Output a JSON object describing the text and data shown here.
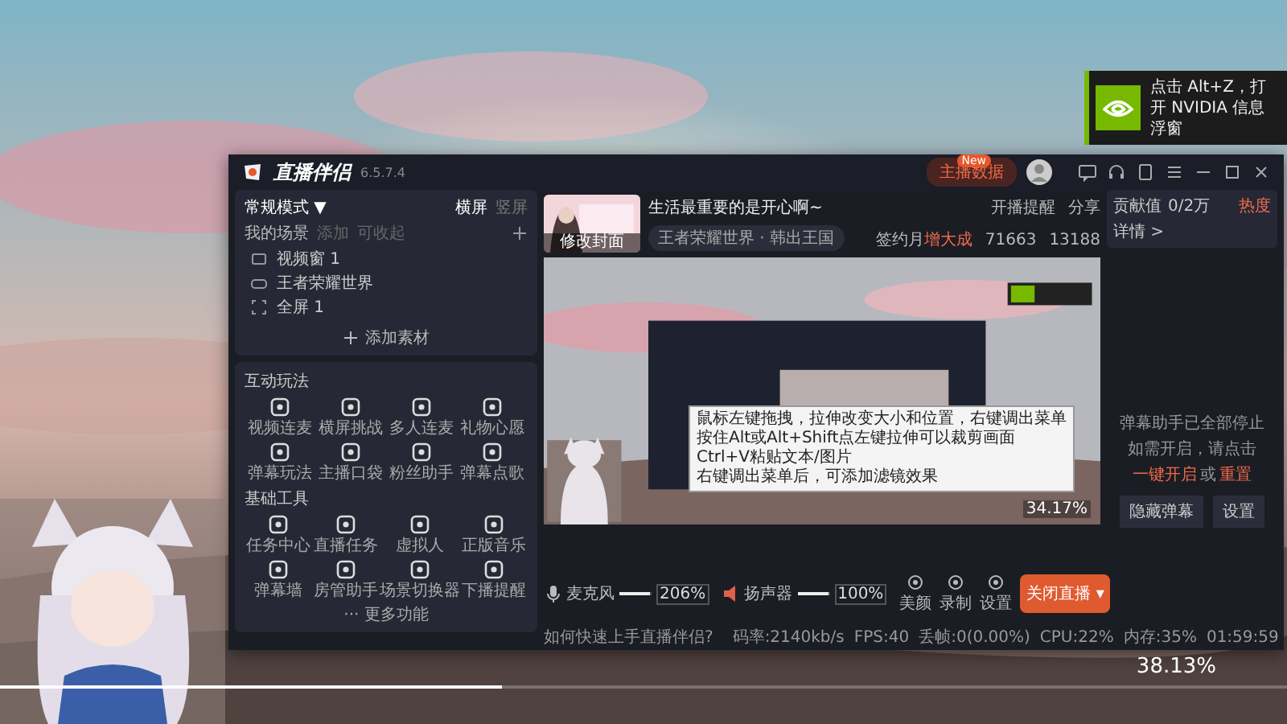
{
  "toast": {
    "text": "点击 Alt+Z，打开 NVIDIA 信息浮窗"
  },
  "app": {
    "name": "直播伴侣",
    "version": "6.5.7.4",
    "data_button": {
      "label": "主播数据",
      "badge": "New"
    }
  },
  "sidebar": {
    "mode": "常规模式 ▼",
    "orientations": [
      {
        "label": "横屏",
        "selected": true
      },
      {
        "label": "竖屏",
        "selected": false
      }
    ],
    "scenes_title": "我的场景",
    "scene_actions": [
      "添加",
      "可收起"
    ],
    "scenes": [
      {
        "kind": "video",
        "label": "视频窗 1"
      },
      {
        "kind": "game",
        "label": "王者荣耀世界"
      },
      {
        "kind": "screen",
        "label": "全屏 1"
      }
    ],
    "add_source": "添加素材",
    "sections": [
      {
        "title": "互动玩法",
        "tools": [
          "视频连麦",
          "横屏挑战",
          "多人连麦",
          "礼物心愿",
          "弹幕玩法",
          "主播口袋",
          "粉丝助手",
          "弹幕点歌"
        ]
      },
      {
        "title": "基础工具",
        "tools": [
          "任务中心",
          "直播任务",
          "虚拟人",
          "正版音乐",
          "弹幕墙",
          "房管助手",
          "场景切换器",
          "下播提醒"
        ]
      }
    ],
    "more": "··· 更多功能"
  },
  "stream": {
    "cover_label": "修改封面",
    "title": "生活最重要的是开心啊~",
    "category": "王者荣耀世界 · 韩出王国",
    "actions": [
      "开播提醒",
      "分享"
    ],
    "signed": "签约月",
    "signed_highlight": "增大成",
    "fans": "71663",
    "likes": "13188"
  },
  "preview": {
    "percent": "34.17%",
    "tooltip": [
      "鼠标左键拖拽，拉伸改变大小和位置，右键调出菜单",
      "按住Alt或Alt+Shift点左键拉伸可以裁剪画面",
      "Ctrl+V粘贴文本/图片",
      "右键调出菜单后，可添加滤镜效果"
    ]
  },
  "audio": [
    {
      "kind": "mic",
      "label": "麦克风",
      "level": 0.95,
      "value": "206%"
    },
    {
      "kind": "speaker",
      "label": "扬声器",
      "level": 0.95,
      "value": "100%"
    }
  ],
  "tools": [
    "美颜",
    "录制",
    "设置"
  ],
  "stop_button": "关闭直播 ▾",
  "status": {
    "help": "如何快速上手直播伴侣?",
    "stats": [
      "码率:2140kb/s",
      "FPS:40",
      "丢帧:0(0.00%)",
      "CPU:22%",
      "内存:35%"
    ],
    "time": "01:59:59"
  },
  "panel": {
    "label": "贡献值",
    "value": "0/2万",
    "heat": "热度",
    "details": "详情 >",
    "notice": "弹幕助手已全部停止",
    "hint": "如需开启，请点击",
    "links": [
      "一键开启",
      "重置"
    ],
    "joiner": "或",
    "buttons": [
      "隐藏弹幕",
      "设置"
    ]
  },
  "overlay": {
    "level": 0.39,
    "percent": "38.13%"
  }
}
